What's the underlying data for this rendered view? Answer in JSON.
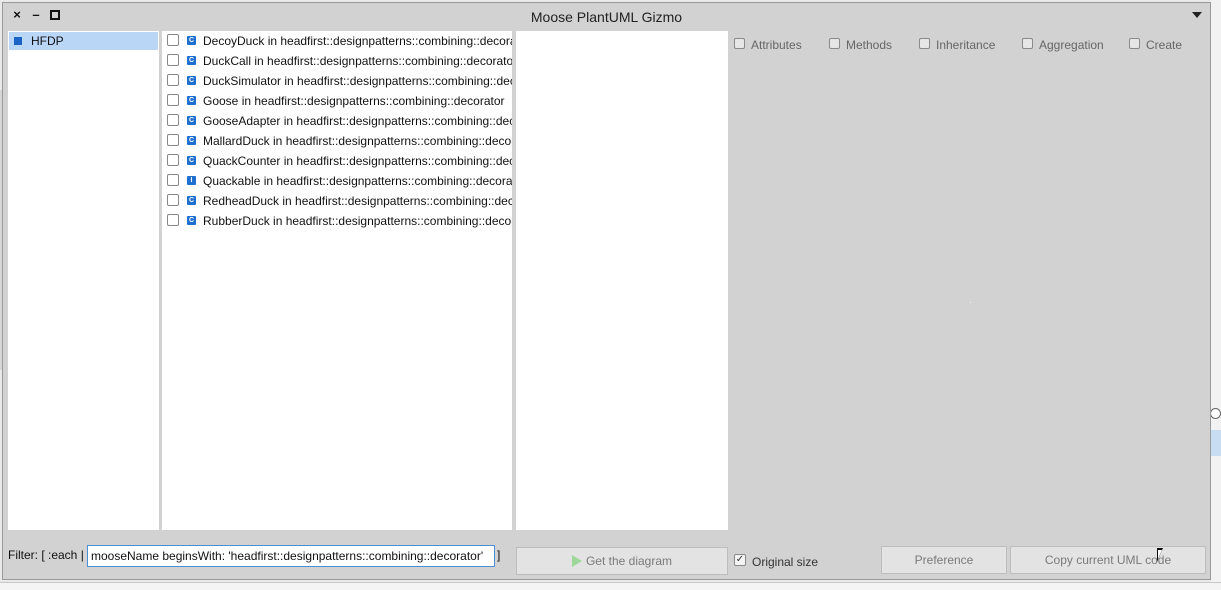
{
  "window": {
    "title": "Moose PlantUML Gizmo"
  },
  "packages": [
    {
      "label": "HFDP",
      "selected": true
    }
  ],
  "classes": [
    {
      "kind": "C",
      "label": "DecoyDuck in headfirst::designpatterns::combining::decorator"
    },
    {
      "kind": "C",
      "label": "DuckCall in headfirst::designpatterns::combining::decorator"
    },
    {
      "kind": "C",
      "label": "DuckSimulator in headfirst::designpatterns::combining::decorator"
    },
    {
      "kind": "C",
      "label": "Goose in headfirst::designpatterns::combining::decorator"
    },
    {
      "kind": "C",
      "label": "GooseAdapter in headfirst::designpatterns::combining::decorator"
    },
    {
      "kind": "C",
      "label": "MallardDuck in headfirst::designpatterns::combining::decorator"
    },
    {
      "kind": "C",
      "label": "QuackCounter in headfirst::designpatterns::combining::decorator"
    },
    {
      "kind": "I",
      "label": "Quackable in headfirst::designpatterns::combining::decorator"
    },
    {
      "kind": "C",
      "label": "RedheadDuck in headfirst::designpatterns::combining::decorator"
    },
    {
      "kind": "C",
      "label": "RubberDuck in headfirst::designpatterns::combining::decorator"
    }
  ],
  "options": {
    "attributes": "Attributes",
    "methods": "Methods",
    "inheritance": "Inheritance",
    "aggregation": "Aggregation",
    "create": "Create"
  },
  "filter": {
    "label": "Filter: [ :each |",
    "value": "mooseName beginsWith: 'headfirst::designpatterns::combining::decorator'",
    "close": "]"
  },
  "buttons": {
    "get_diagram": "Get the diagram",
    "preference": "Preference",
    "copy_uml": "Copy current UML code"
  },
  "original_size": {
    "label": "Original size",
    "checked": true,
    "check_glyph": "✓"
  },
  "colors": {
    "accent": "#1e6fcf",
    "selection": "#b9d6f7",
    "play": "#9ed79a"
  }
}
